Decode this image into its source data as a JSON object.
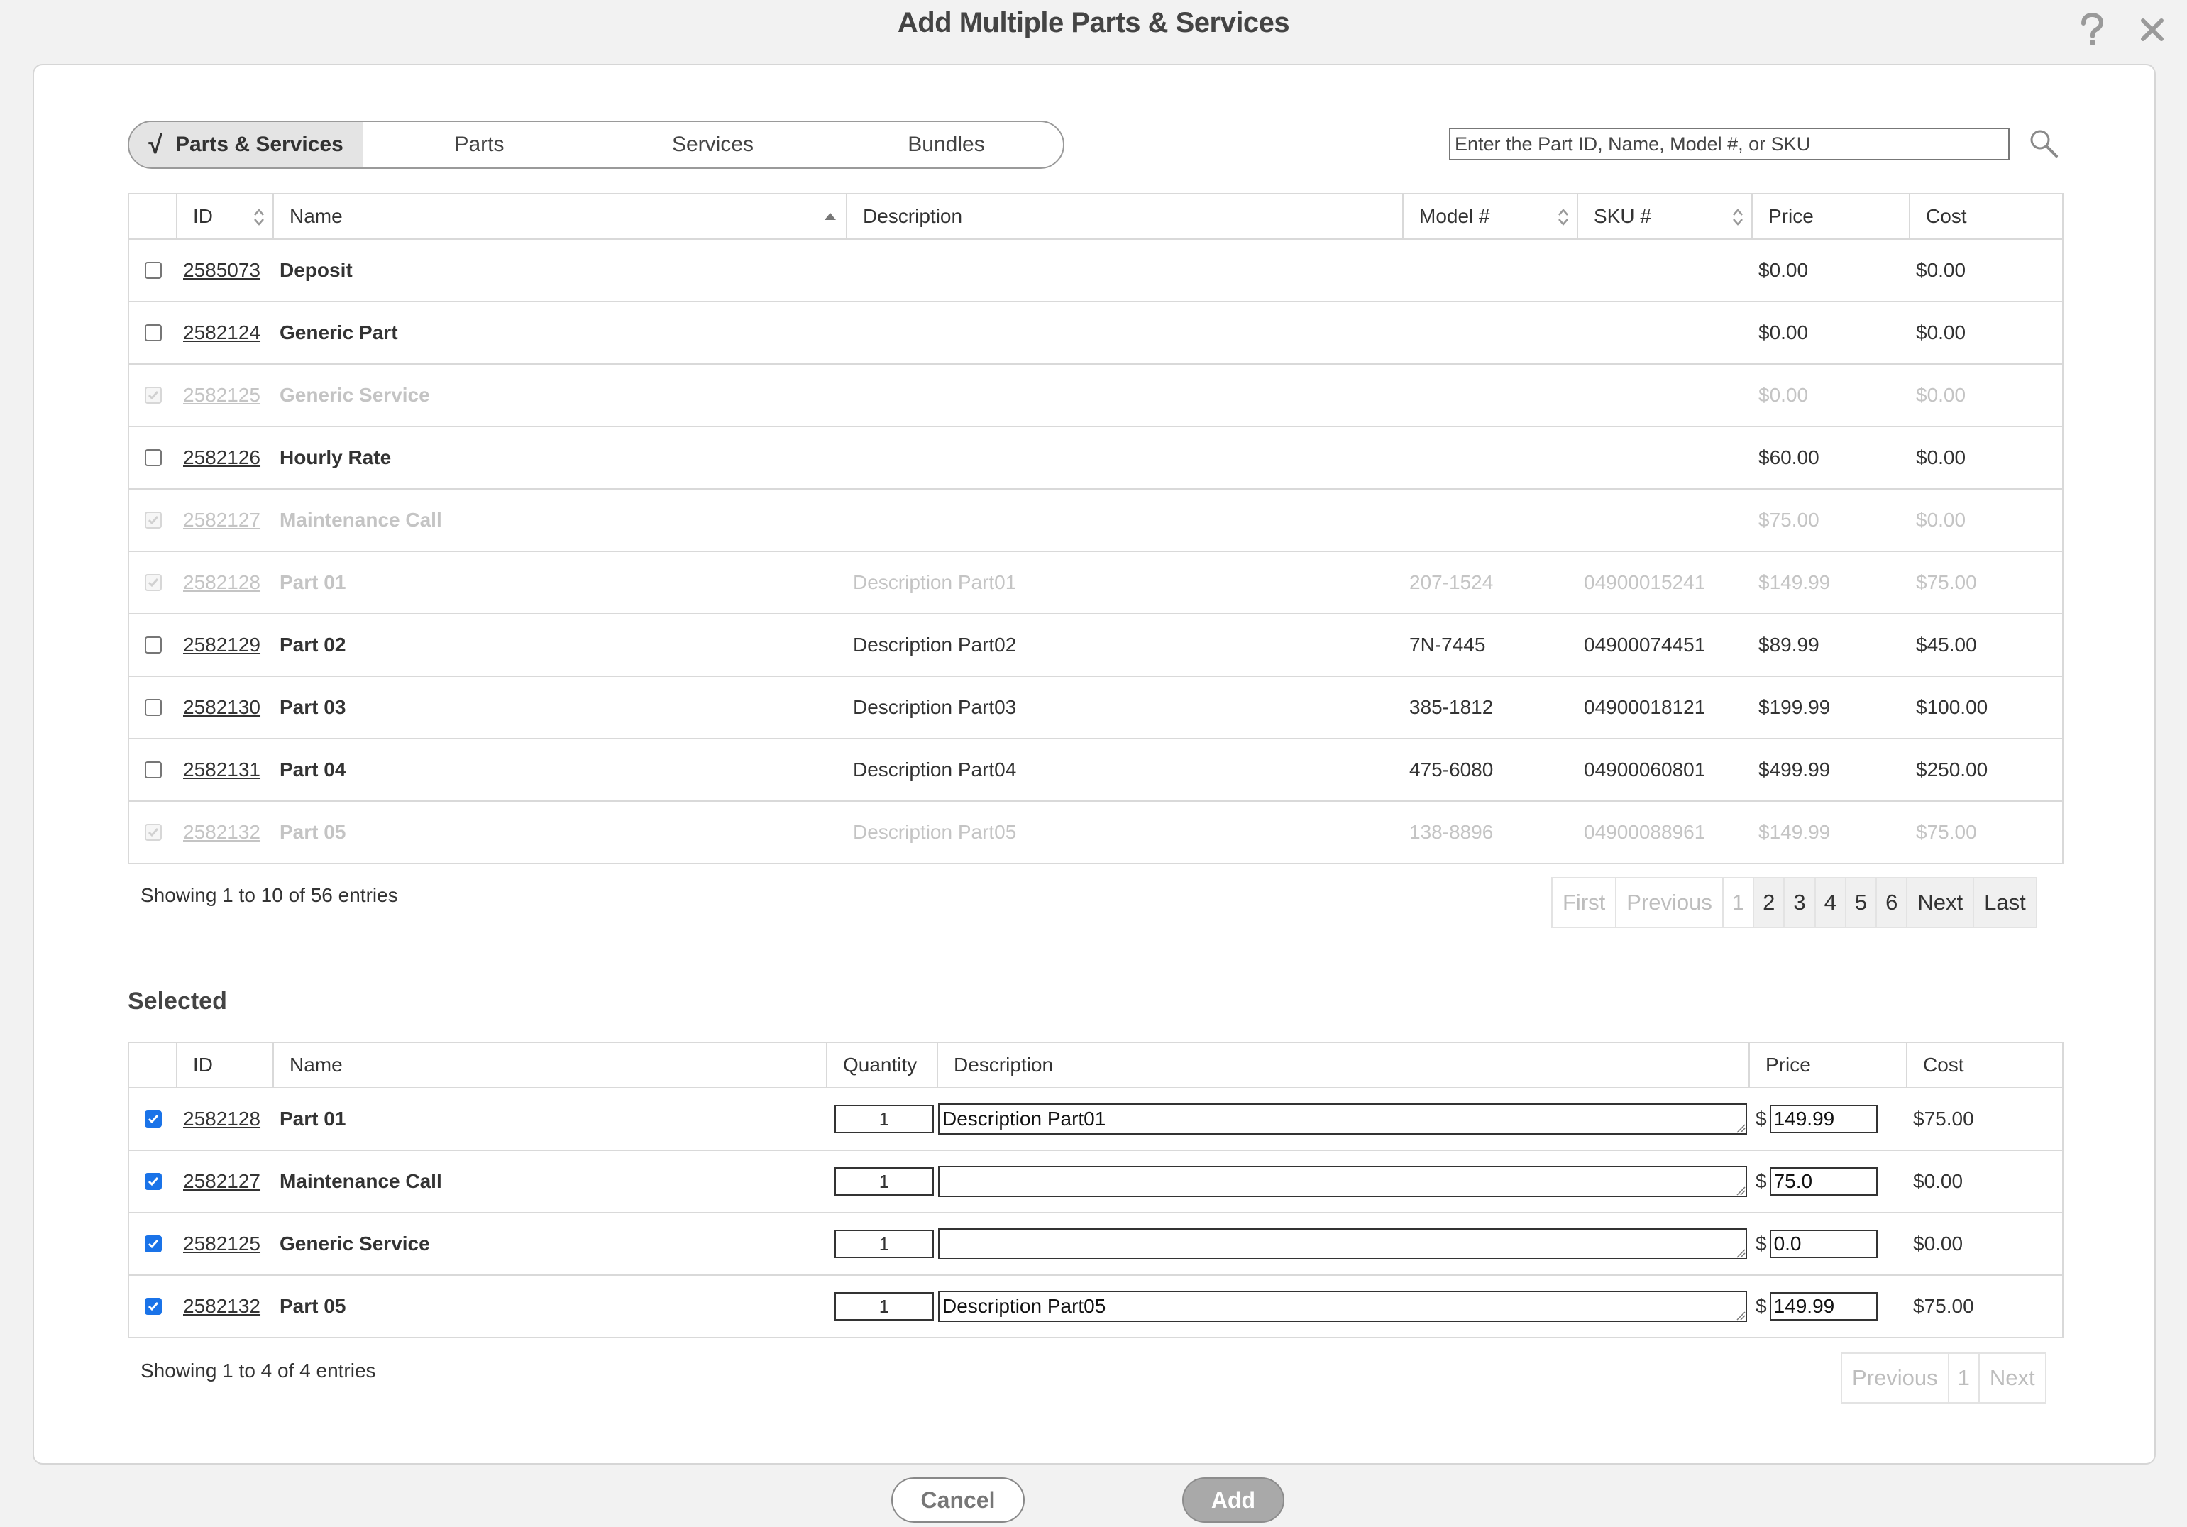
{
  "dialog": {
    "title": "Add Multiple Parts & Services",
    "help_icon": "question-mark-icon",
    "close_icon": "close-x-icon"
  },
  "filter_tabs": {
    "active_check": "√",
    "items": [
      "Parts & Services",
      "Parts",
      "Services",
      "Bundles"
    ],
    "active_index": 0
  },
  "search": {
    "placeholder": "Enter the Part ID, Name, Model #, or SKU",
    "value": "",
    "icon": "magnifier-icon"
  },
  "catalog_table": {
    "columns": [
      "ID",
      "Name",
      "Description",
      "Model #",
      "SKU #",
      "Price",
      "Cost"
    ],
    "rows": [
      {
        "id": "2585073",
        "name": "Deposit",
        "description": "",
        "model": "",
        "sku": "",
        "price": "$0.00",
        "cost": "$0.00",
        "state": "unchecked"
      },
      {
        "id": "2582124",
        "name": "Generic Part",
        "description": "",
        "model": "",
        "sku": "",
        "price": "$0.00",
        "cost": "$0.00",
        "state": "unchecked"
      },
      {
        "id": "2582125",
        "name": "Generic Service",
        "description": "",
        "model": "",
        "sku": "",
        "price": "$0.00",
        "cost": "$0.00",
        "state": "disabled"
      },
      {
        "id": "2582126",
        "name": "Hourly Rate",
        "description": "",
        "model": "",
        "sku": "",
        "price": "$60.00",
        "cost": "$0.00",
        "state": "unchecked"
      },
      {
        "id": "2582127",
        "name": "Maintenance Call",
        "description": "",
        "model": "",
        "sku": "",
        "price": "$75.00",
        "cost": "$0.00",
        "state": "disabled"
      },
      {
        "id": "2582128",
        "name": "Part 01",
        "description": "Description Part01",
        "model": "207-1524",
        "sku": "04900015241",
        "price": "$149.99",
        "cost": "$75.00",
        "state": "disabled"
      },
      {
        "id": "2582129",
        "name": "Part 02",
        "description": "Description Part02",
        "model": "7N-7445",
        "sku": "04900074451",
        "price": "$89.99",
        "cost": "$45.00",
        "state": "unchecked"
      },
      {
        "id": "2582130",
        "name": "Part 03",
        "description": "Description Part03",
        "model": "385-1812",
        "sku": "04900018121",
        "price": "$199.99",
        "cost": "$100.00",
        "state": "unchecked"
      },
      {
        "id": "2582131",
        "name": "Part 04",
        "description": "Description Part04",
        "model": "475-6080",
        "sku": "04900060801",
        "price": "$499.99",
        "cost": "$250.00",
        "state": "unchecked"
      },
      {
        "id": "2582132",
        "name": "Part 05",
        "description": "Description Part05",
        "model": "138-8896",
        "sku": "04900088961",
        "price": "$149.99",
        "cost": "$75.00",
        "state": "disabled"
      }
    ],
    "info": "Showing 1 to 10 of 56 entries",
    "pagination": {
      "first": "First",
      "previous": "Previous",
      "pages": [
        "1",
        "2",
        "3",
        "4",
        "5",
        "6"
      ],
      "current_page": "1",
      "next": "Next",
      "last": "Last"
    }
  },
  "selected_section": {
    "title": "Selected",
    "columns": [
      "ID",
      "Name",
      "Quantity",
      "Description",
      "Price",
      "Cost"
    ],
    "currency_symbol": "$",
    "rows": [
      {
        "id": "2582128",
        "name": "Part 01",
        "quantity": "1",
        "description": "Description Part01",
        "price": "149.99",
        "cost": "$75.00"
      },
      {
        "id": "2582127",
        "name": "Maintenance Call",
        "quantity": "1",
        "description": "",
        "price": "75.0",
        "cost": "$0.00"
      },
      {
        "id": "2582125",
        "name": "Generic Service",
        "quantity": "1",
        "description": "",
        "price": "0.0",
        "cost": "$0.00"
      },
      {
        "id": "2582132",
        "name": "Part 05",
        "quantity": "1",
        "description": "Description Part05",
        "price": "149.99",
        "cost": "$75.00"
      }
    ],
    "info": "Showing 1 to 4 of 4 entries",
    "pagination": {
      "previous": "Previous",
      "pages": [
        "1"
      ],
      "next": "Next"
    }
  },
  "footer": {
    "cancel_label": "Cancel",
    "add_label": "Add"
  },
  "colors": {
    "checkbox_checked": "#1a73e8",
    "add_button_bg": "#a9a9a9",
    "disabled_text": "#c4c4c4"
  }
}
